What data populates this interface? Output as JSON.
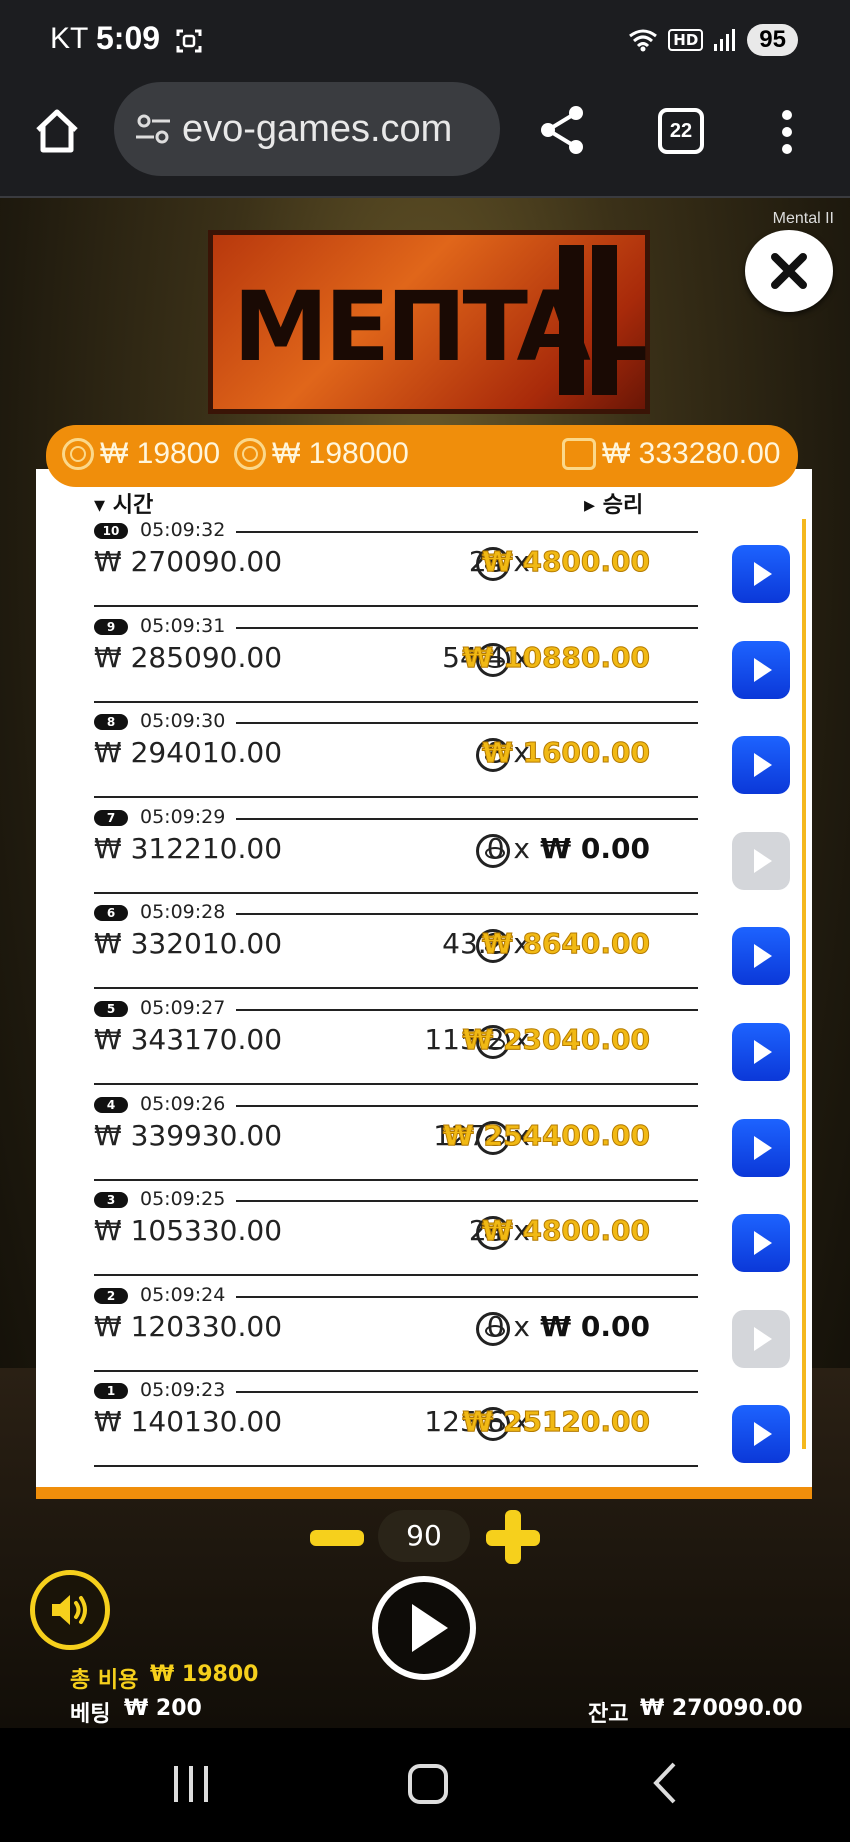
{
  "status": {
    "carrier": "KT",
    "time": "5:09",
    "battery": "95",
    "hd": "HD"
  },
  "browser": {
    "url": "evo-games.com",
    "tab_count": "22"
  },
  "game": {
    "name": "Mental II",
    "logo_text": "MEΠTAL",
    "header": {
      "cost": "₩ 19800",
      "max_win": "₩ 198000",
      "balance": "₩ 333280.00"
    },
    "columns": {
      "time": "시간",
      "win": "승리"
    },
    "rounds": [
      {
        "num": "10",
        "time": "05:09:32",
        "balance": "₩ 270090.00",
        "multiplier": "24 x",
        "win": "₩ 4800.00",
        "active": true
      },
      {
        "num": "9",
        "time": "05:09:31",
        "balance": "₩ 285090.00",
        "multiplier": "54.4 x",
        "win": "₩ 10880.00",
        "active": true
      },
      {
        "num": "8",
        "time": "05:09:30",
        "balance": "₩ 294010.00",
        "multiplier": "8 x",
        "win": "₩ 1600.00",
        "active": true
      },
      {
        "num": "7",
        "time": "05:09:29",
        "balance": "₩ 312210.00",
        "multiplier": "0 x",
        "win": "₩ 0.00",
        "active": false
      },
      {
        "num": "6",
        "time": "05:09:28",
        "balance": "₩ 332010.00",
        "multiplier": "43.2 x",
        "win": "₩ 8640.00",
        "active": true
      },
      {
        "num": "5",
        "time": "05:09:27",
        "balance": "₩ 343170.00",
        "multiplier": "115.2 x",
        "win": "₩ 23040.00",
        "active": true
      },
      {
        "num": "4",
        "time": "05:09:26",
        "balance": "₩ 339930.00",
        "multiplier": "1272 x",
        "win": "₩ 254400.00",
        "active": true
      },
      {
        "num": "3",
        "time": "05:09:25",
        "balance": "₩ 105330.00",
        "multiplier": "24 x",
        "win": "₩ 4800.00",
        "active": true
      },
      {
        "num": "2",
        "time": "05:09:24",
        "balance": "₩ 120330.00",
        "multiplier": "0 x",
        "win": "₩ 0.00",
        "active": false
      },
      {
        "num": "1",
        "time": "05:09:23",
        "balance": "₩ 140130.00",
        "multiplier": "125.6 x",
        "win": "₩ 25120.00",
        "active": true
      }
    ],
    "stepper_value": "90",
    "footer": {
      "total_cost_label": "총 비용",
      "total_cost": "₩ 19800",
      "bet_label": "베팅",
      "bet": "₩ 200",
      "balance_label": "잔고",
      "balance": "₩ 270090.00"
    }
  },
  "colors": {
    "accent": "#f08e0b",
    "win_gold": "#f1b914",
    "play_blue": "#1d63ff",
    "highlight_yellow": "#f6d01c"
  }
}
